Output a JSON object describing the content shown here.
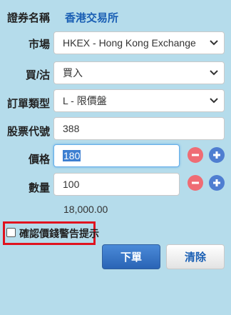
{
  "security": {
    "label": "證券名稱",
    "value": "香港交易所"
  },
  "market": {
    "label": "市場",
    "selected": "HKEX - Hong Kong Exchange"
  },
  "side": {
    "label": "買/沽",
    "selected": "買入"
  },
  "order_type": {
    "label": "訂單類型",
    "selected": "L - 限價盤"
  },
  "stock_code": {
    "label": "股票代號",
    "value": "388"
  },
  "price": {
    "label": "價格",
    "value": "180"
  },
  "quantity": {
    "label": "數量",
    "value": "100"
  },
  "amount": "18,000.00",
  "warning": {
    "label": "確認價錢警告提示",
    "checked": false
  },
  "buttons": {
    "order": "下單",
    "clear": "清除"
  },
  "colors": {
    "background": "#b5dceb",
    "accent": "#1a5fb4",
    "minus": "#ef6c74",
    "plus": "#4f7ed1",
    "highlight": "#e0131f"
  }
}
